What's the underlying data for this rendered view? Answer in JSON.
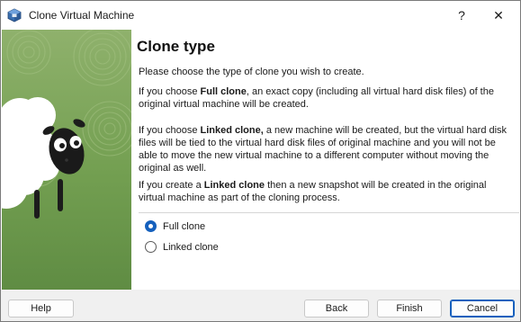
{
  "window": {
    "title": "Clone Virtual Machine",
    "help_glyph": "?",
    "close_glyph": "✕"
  },
  "content": {
    "heading": "Clone type",
    "intro": "Please choose the type of clone you wish to create.",
    "full_clone_para": {
      "prefix": "If you choose ",
      "bold": "Full clone",
      "suffix": ", an exact copy (including all virtual hard disk files) of the original virtual machine will be created."
    },
    "linked_clone_para": {
      "prefix": "If you choose ",
      "bold": "Linked clone,",
      "suffix": " a new machine will be created, but the virtual hard disk files will be tied to the virtual hard disk files of original machine and you will not be able to move the new virtual machine to a different computer without moving the original as well."
    },
    "snapshot_para": {
      "prefix": "If you create a ",
      "bold": "Linked clone",
      "suffix": " then a new snapshot will be created in the original virtual machine as part of the cloning process."
    }
  },
  "options": {
    "full_clone_label": "Full clone",
    "linked_clone_label": "Linked clone",
    "selected": "Full clone"
  },
  "footer": {
    "help_label": "Help",
    "back_label": "Back",
    "finish_label": "Finish",
    "cancel_label": "Cancel"
  },
  "colors": {
    "accent": "#1560bd",
    "illustration_green": "#6f9a4e"
  },
  "icons": {
    "app": "virtualbox-icon",
    "illustration": "sheep-illustration"
  }
}
